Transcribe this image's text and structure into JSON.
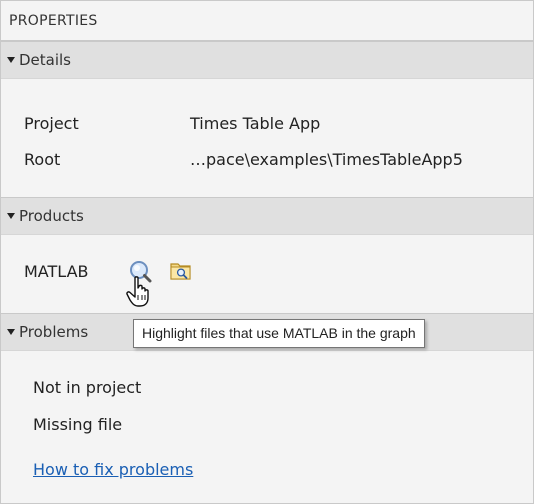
{
  "panel": {
    "title": "PROPERTIES"
  },
  "details": {
    "header": "Details",
    "rows": [
      {
        "label": "Project",
        "value": "Times Table App"
      },
      {
        "label": "Root",
        "value": "…pace\\examples\\TimesTableApp5"
      }
    ]
  },
  "products": {
    "header": "Products",
    "item_label": "MATLAB",
    "highlight_icon": "magnifier-icon",
    "browse_icon": "folder-search-icon"
  },
  "problems": {
    "header": "Problems",
    "items": [
      "Not in project",
      "Missing file"
    ],
    "help_link": "How to fix problems"
  },
  "tooltip": {
    "text": "Highlight files that use MATLAB in the graph"
  },
  "colors": {
    "section_header_bg": "#e0e0e0",
    "panel_bg": "#f4f4f4",
    "link": "#1a5fb4"
  }
}
